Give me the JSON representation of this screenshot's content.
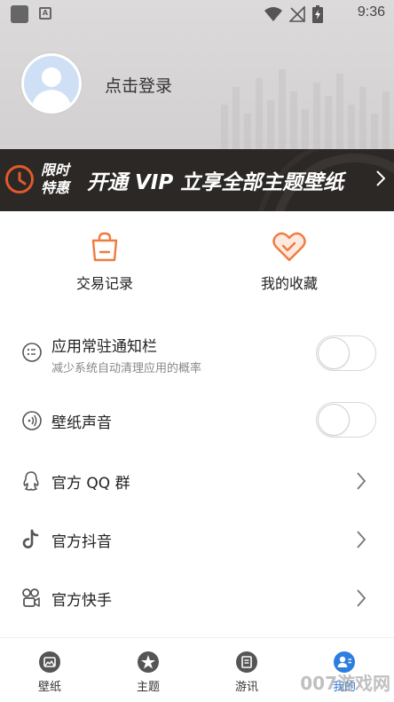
{
  "status_bar": {
    "notif_letter": "A",
    "time": "9:36"
  },
  "profile": {
    "login_label": "点击登录"
  },
  "vip_banner": {
    "badge_line1": "限时",
    "badge_line2": "特惠",
    "text": "开通 VIP 立享全部主题壁纸",
    "accent": "#e05a2b"
  },
  "quick_actions": [
    {
      "label": "交易记录",
      "icon": "shopping-bag-icon"
    },
    {
      "label": "我的收藏",
      "icon": "heart-icon"
    }
  ],
  "settings": [
    {
      "title": "应用常驻通知栏",
      "subtitle": "减少系统自动清理应用的概率",
      "icon": "notification-icon",
      "toggle": false
    },
    {
      "title": "壁纸声音",
      "icon": "sound-icon",
      "toggle": false
    },
    {
      "title": "官方 QQ 群",
      "icon": "qq-icon"
    },
    {
      "title": "官方抖音",
      "icon": "douyin-icon"
    },
    {
      "title": "官方快手",
      "icon": "kuaishou-icon"
    }
  ],
  "bottom_nav": [
    {
      "label": "壁纸",
      "icon": "wallpaper-icon",
      "active": false
    },
    {
      "label": "主题",
      "icon": "theme-icon",
      "active": false
    },
    {
      "label": "游讯",
      "icon": "news-icon",
      "active": false
    },
    {
      "label": "我的",
      "icon": "profile-icon",
      "active": true
    }
  ],
  "watermark": "007游戏网",
  "colors": {
    "accent": "#f07a3e",
    "banner_bg": "#2b2826",
    "active_nav": "#2e7de0"
  }
}
